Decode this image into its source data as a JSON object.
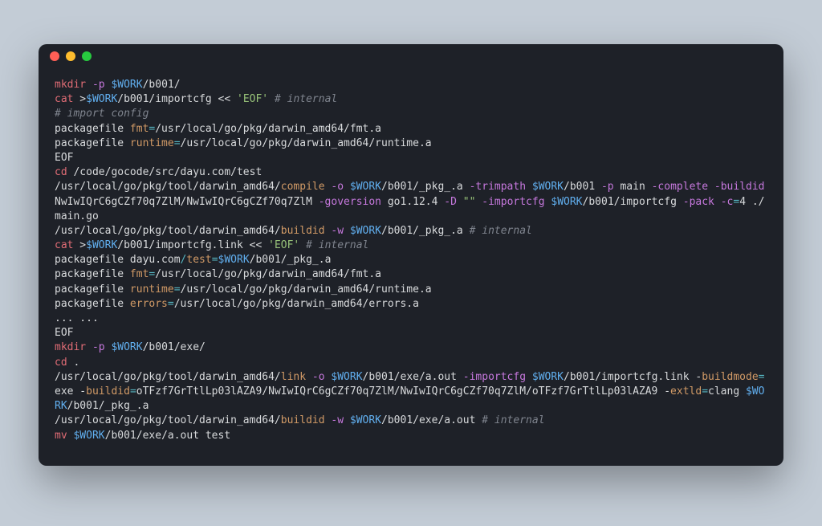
{
  "window": {
    "traffic_lights": [
      "red",
      "yellow",
      "green"
    ]
  },
  "colors": {
    "bg_page": "#c3ccd6",
    "bg_window": "#1e2128",
    "red": "#e06c75",
    "blue": "#61afef",
    "purple": "#c678dd",
    "green": "#98c379",
    "grey": "#7f848e",
    "orange": "#d19a66",
    "teal": "#56b6c2",
    "fg": "#d8dadc"
  },
  "code_lines": [
    [
      {
        "cls": "c-cmd",
        "t": "mkdir"
      },
      {
        "cls": "c-plain",
        "t": " "
      },
      {
        "cls": "c-flag",
        "t": "-p"
      },
      {
        "cls": "c-plain",
        "t": " "
      },
      {
        "cls": "c-var",
        "t": "$WORK"
      },
      {
        "cls": "c-plain",
        "t": "/b001/"
      }
    ],
    [
      {
        "cls": "c-cmd",
        "t": "cat"
      },
      {
        "cls": "c-plain",
        "t": " >"
      },
      {
        "cls": "c-var",
        "t": "$WORK"
      },
      {
        "cls": "c-plain",
        "t": "/b001/importcfg << "
      },
      {
        "cls": "c-str",
        "t": "'EOF'"
      },
      {
        "cls": "c-plain",
        "t": " "
      },
      {
        "cls": "c-comm",
        "t": "# internal"
      }
    ],
    [
      {
        "cls": "c-comm",
        "t": "# import config"
      }
    ],
    [
      {
        "cls": "c-plain",
        "t": "packagefile "
      },
      {
        "cls": "c-name",
        "t": "fmt"
      },
      {
        "cls": "c-punc",
        "t": "="
      },
      {
        "cls": "c-plain",
        "t": "/usr/local/go/pkg/darwin_amd64/fmt.a"
      }
    ],
    [
      {
        "cls": "c-plain",
        "t": "packagefile "
      },
      {
        "cls": "c-name",
        "t": "runtime"
      },
      {
        "cls": "c-punc",
        "t": "="
      },
      {
        "cls": "c-plain",
        "t": "/usr/local/go/pkg/darwin_amd64/runtime.a"
      }
    ],
    [
      {
        "cls": "c-plain",
        "t": "EOF"
      }
    ],
    [
      {
        "cls": "c-cmd",
        "t": "cd"
      },
      {
        "cls": "c-plain",
        "t": " /code/gocode/src/dayu.com/test"
      }
    ],
    [
      {
        "cls": "c-plain",
        "t": "/usr/local/go/pkg/tool/darwin_amd64/"
      },
      {
        "cls": "c-name",
        "t": "compile"
      },
      {
        "cls": "c-plain",
        "t": " "
      },
      {
        "cls": "c-flag",
        "t": "-o"
      },
      {
        "cls": "c-plain",
        "t": " "
      },
      {
        "cls": "c-var",
        "t": "$WORK"
      },
      {
        "cls": "c-plain",
        "t": "/b001/_pkg_.a "
      },
      {
        "cls": "c-flag",
        "t": "-trimpath"
      },
      {
        "cls": "c-plain",
        "t": " "
      },
      {
        "cls": "c-var",
        "t": "$WORK"
      },
      {
        "cls": "c-plain",
        "t": "/b001 "
      },
      {
        "cls": "c-flag",
        "t": "-p"
      },
      {
        "cls": "c-plain",
        "t": " main "
      },
      {
        "cls": "c-flag",
        "t": "-complete"
      },
      {
        "cls": "c-plain",
        "t": " "
      },
      {
        "cls": "c-flag",
        "t": "-buildid"
      },
      {
        "cls": "c-plain",
        "t": " NwIwIQrC6gCZf70q7ZlM/NwIwIQrC6gCZf70q7ZlM "
      },
      {
        "cls": "c-flag",
        "t": "-goversion"
      },
      {
        "cls": "c-plain",
        "t": " go1.12.4 "
      },
      {
        "cls": "c-flag",
        "t": "-D"
      },
      {
        "cls": "c-plain",
        "t": " "
      },
      {
        "cls": "c-str",
        "t": "\"\""
      },
      {
        "cls": "c-plain",
        "t": " "
      },
      {
        "cls": "c-flag",
        "t": "-importcfg"
      },
      {
        "cls": "c-plain",
        "t": " "
      },
      {
        "cls": "c-var",
        "t": "$WORK"
      },
      {
        "cls": "c-plain",
        "t": "/b001/importcfg "
      },
      {
        "cls": "c-flag",
        "t": "-pack"
      },
      {
        "cls": "c-plain",
        "t": " "
      },
      {
        "cls": "c-flag",
        "t": "-c"
      },
      {
        "cls": "c-punc",
        "t": "="
      },
      {
        "cls": "c-plain",
        "t": "4 ./main.go"
      }
    ],
    [
      {
        "cls": "c-plain",
        "t": "/usr/local/go/pkg/tool/darwin_amd64/"
      },
      {
        "cls": "c-name",
        "t": "buildid"
      },
      {
        "cls": "c-plain",
        "t": " "
      },
      {
        "cls": "c-flag",
        "t": "-w"
      },
      {
        "cls": "c-plain",
        "t": " "
      },
      {
        "cls": "c-var",
        "t": "$WORK"
      },
      {
        "cls": "c-plain",
        "t": "/b001/_pkg_.a "
      },
      {
        "cls": "c-comm",
        "t": "# internal"
      }
    ],
    [
      {
        "cls": "c-cmd",
        "t": "cat"
      },
      {
        "cls": "c-plain",
        "t": " >"
      },
      {
        "cls": "c-var",
        "t": "$WORK"
      },
      {
        "cls": "c-plain",
        "t": "/b001/importcfg.link << "
      },
      {
        "cls": "c-str",
        "t": "'EOF'"
      },
      {
        "cls": "c-plain",
        "t": " "
      },
      {
        "cls": "c-comm",
        "t": "# internal"
      }
    ],
    [
      {
        "cls": "c-plain",
        "t": "packagefile dayu.com"
      },
      {
        "cls": "c-punc",
        "t": "/"
      },
      {
        "cls": "c-name",
        "t": "test"
      },
      {
        "cls": "c-punc",
        "t": "="
      },
      {
        "cls": "c-var",
        "t": "$WORK"
      },
      {
        "cls": "c-plain",
        "t": "/b001/_pkg_.a"
      }
    ],
    [
      {
        "cls": "c-plain",
        "t": "packagefile "
      },
      {
        "cls": "c-name",
        "t": "fmt"
      },
      {
        "cls": "c-punc",
        "t": "="
      },
      {
        "cls": "c-plain",
        "t": "/usr/local/go/pkg/darwin_amd64/fmt.a"
      }
    ],
    [
      {
        "cls": "c-plain",
        "t": "packagefile "
      },
      {
        "cls": "c-name",
        "t": "runtime"
      },
      {
        "cls": "c-punc",
        "t": "="
      },
      {
        "cls": "c-plain",
        "t": "/usr/local/go/pkg/darwin_amd64/runtime.a"
      }
    ],
    [
      {
        "cls": "c-plain",
        "t": "packagefile "
      },
      {
        "cls": "c-name",
        "t": "errors"
      },
      {
        "cls": "c-punc",
        "t": "="
      },
      {
        "cls": "c-plain",
        "t": "/usr/local/go/pkg/darwin_amd64/errors.a"
      }
    ],
    [
      {
        "cls": "c-plain",
        "t": "... ..."
      }
    ],
    [
      {
        "cls": "c-plain",
        "t": "EOF"
      }
    ],
    [
      {
        "cls": "c-cmd",
        "t": "mkdir"
      },
      {
        "cls": "c-plain",
        "t": " "
      },
      {
        "cls": "c-flag",
        "t": "-p"
      },
      {
        "cls": "c-plain",
        "t": " "
      },
      {
        "cls": "c-var",
        "t": "$WORK"
      },
      {
        "cls": "c-plain",
        "t": "/b001/exe/"
      }
    ],
    [
      {
        "cls": "c-cmd",
        "t": "cd"
      },
      {
        "cls": "c-plain",
        "t": " ."
      }
    ],
    [
      {
        "cls": "c-plain",
        "t": "/usr/local/go/pkg/tool/darwin_amd64/"
      },
      {
        "cls": "c-name",
        "t": "link"
      },
      {
        "cls": "c-plain",
        "t": " "
      },
      {
        "cls": "c-flag",
        "t": "-o"
      },
      {
        "cls": "c-plain",
        "t": " "
      },
      {
        "cls": "c-var",
        "t": "$WORK"
      },
      {
        "cls": "c-plain",
        "t": "/b001/exe/a.out "
      },
      {
        "cls": "c-flag",
        "t": "-importcfg"
      },
      {
        "cls": "c-plain",
        "t": " "
      },
      {
        "cls": "c-var",
        "t": "$WORK"
      },
      {
        "cls": "c-plain",
        "t": "/b001/importcfg.link -"
      },
      {
        "cls": "c-name",
        "t": "buildmode"
      },
      {
        "cls": "c-punc",
        "t": "="
      },
      {
        "cls": "c-plain",
        "t": "exe -"
      },
      {
        "cls": "c-name",
        "t": "buildid"
      },
      {
        "cls": "c-punc",
        "t": "="
      },
      {
        "cls": "c-plain",
        "t": "oTFzf7GrTtlLp03lAZA9/NwIwIQrC6gCZf70q7ZlM/NwIwIQrC6gCZf70q7ZlM/oTFzf7GrTtlLp03lAZA9 -"
      },
      {
        "cls": "c-name",
        "t": "extld"
      },
      {
        "cls": "c-punc",
        "t": "="
      },
      {
        "cls": "c-plain",
        "t": "clang "
      },
      {
        "cls": "c-var",
        "t": "$WORK"
      },
      {
        "cls": "c-plain",
        "t": "/b001/_pkg_.a"
      }
    ],
    [
      {
        "cls": "c-plain",
        "t": "/usr/local/go/pkg/tool/darwin_amd64/"
      },
      {
        "cls": "c-name",
        "t": "buildid"
      },
      {
        "cls": "c-plain",
        "t": " "
      },
      {
        "cls": "c-flag",
        "t": "-w"
      },
      {
        "cls": "c-plain",
        "t": " "
      },
      {
        "cls": "c-var",
        "t": "$WORK"
      },
      {
        "cls": "c-plain",
        "t": "/b001/exe/a.out "
      },
      {
        "cls": "c-comm",
        "t": "# internal"
      }
    ],
    [
      {
        "cls": "c-cmd",
        "t": "mv"
      },
      {
        "cls": "c-plain",
        "t": " "
      },
      {
        "cls": "c-var",
        "t": "$WORK"
      },
      {
        "cls": "c-plain",
        "t": "/b001/exe/a.out test"
      }
    ]
  ]
}
